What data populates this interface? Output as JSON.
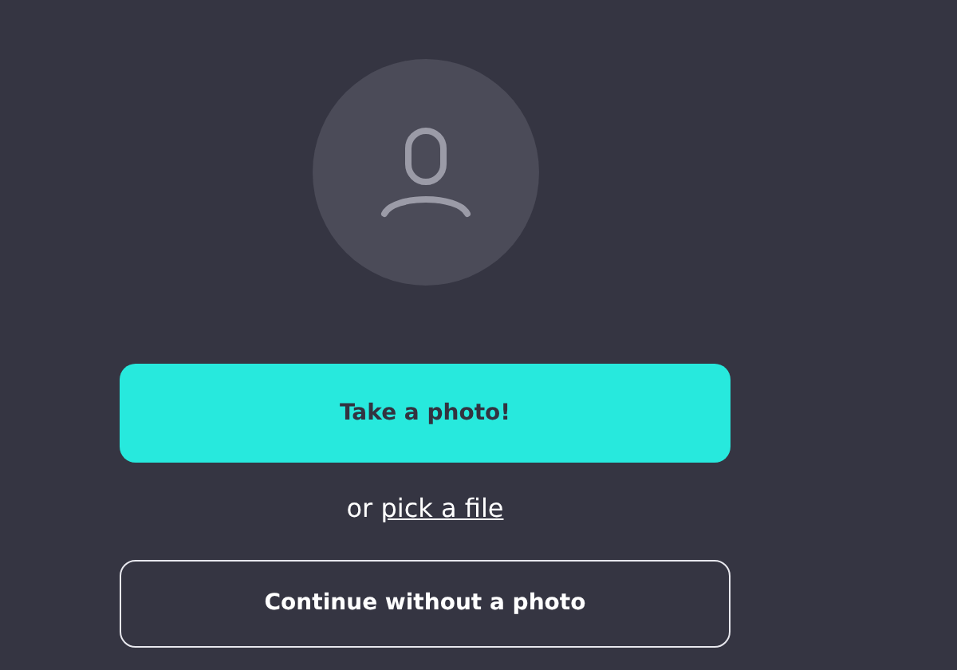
{
  "primary_button": {
    "label": "Take a photo!"
  },
  "alternative": {
    "prefix": "or",
    "link": "pick a file"
  },
  "secondary_button": {
    "label": "Continue without a photo"
  }
}
